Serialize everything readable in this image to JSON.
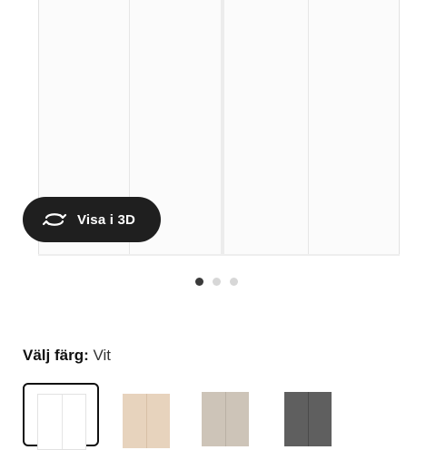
{
  "viewer": {
    "view_3d_label": "Visa i 3D",
    "icon": "rotate-3d-icon"
  },
  "carousel": {
    "dots": [
      {
        "active": true
      },
      {
        "active": false
      },
      {
        "active": false
      }
    ]
  },
  "color_selector": {
    "label": "Välj färg:",
    "selected_value": "Vit",
    "swatches": [
      {
        "color": "#ffffff",
        "edge": "#e5e5e5",
        "selected": true
      },
      {
        "color": "#e7d3bd",
        "edge": "#d7c0a6",
        "selected": false
      },
      {
        "color": "#cdc4b8",
        "edge": "#b9b0a4",
        "selected": false
      },
      {
        "color": "#5f5f5f",
        "edge": "#4a4a4a",
        "selected": false
      }
    ]
  }
}
